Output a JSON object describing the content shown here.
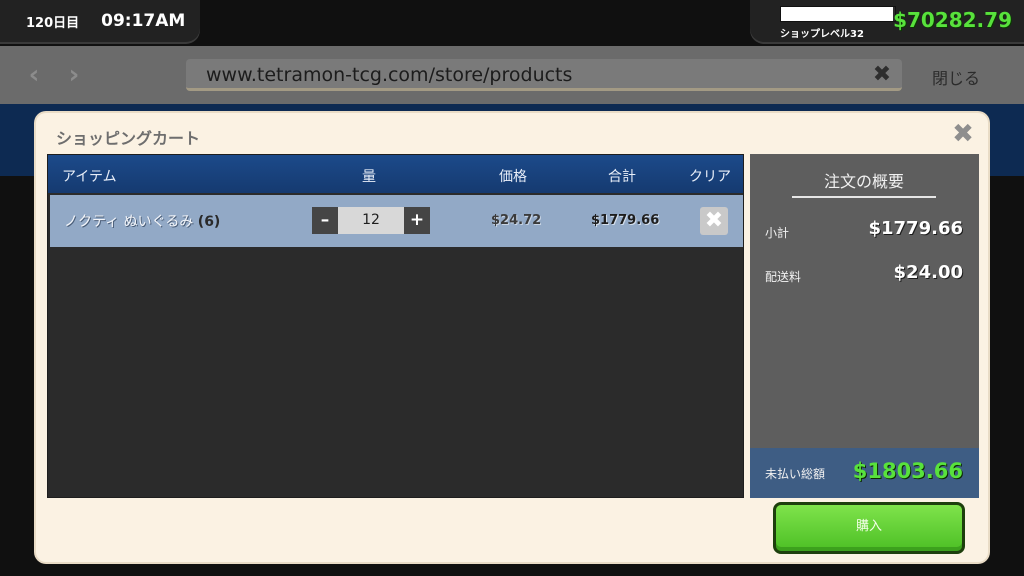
{
  "hud": {
    "day": "120日目",
    "time": "09:17AM",
    "shop_level": "ショップレベル32",
    "xp_progress": 0.98,
    "money": "$70282.79"
  },
  "browser": {
    "url": "www.tetramon-tcg.com/store/products",
    "close_label": "閉じる"
  },
  "cart": {
    "title": "ショッピングカート",
    "columns": {
      "item": "アイテム",
      "quantity": "量",
      "price": "価格",
      "total": "合計",
      "clear": "クリア"
    },
    "items": [
      {
        "name": "ノクティ ぬいぐるみ",
        "count": "(6)",
        "quantity": "12",
        "price": "$24.72",
        "total": "$1779.66"
      }
    ]
  },
  "summary": {
    "title": "注文の概要",
    "subtotal_label": "小計",
    "subtotal": "$1779.66",
    "shipping_label": "配送料",
    "shipping": "$24.00",
    "total_label": "未払い総額",
    "total": "$1803.66"
  },
  "buy_label": "購入",
  "colors": {
    "money_green": "#58e23c",
    "header_blue": "#1c4a8a",
    "row_blue": "#92a9c6",
    "buy_green": "#6bd63c"
  }
}
